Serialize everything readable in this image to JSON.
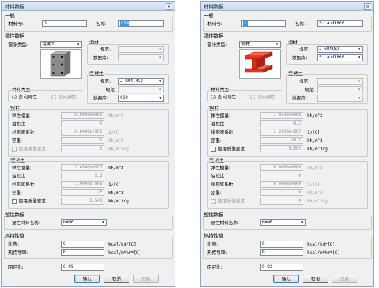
{
  "labels": {
    "dialog_title": "材料数据",
    "close_glyph": "x",
    "general": "一般",
    "mat_no": "材料号:",
    "name": "名称:",
    "elastic": "弹性数据",
    "design_type": "设计类型:",
    "steel_group": "钢材",
    "code": "规范:",
    "database": "数据库:",
    "concrete_group": "混凝土",
    "code_cn": "规范",
    "mat_type": "材料类型",
    "iso": "各向同性",
    "aniso": "各向异性",
    "steel_sec": "钢材",
    "concrete_sec": "混凝土",
    "modulus": "弹性模量:",
    "poisson": "泊松比:",
    "thermal": "线膨胀系数:",
    "weight": "容重:",
    "use_mass": "使用质量密度",
    "u_modulus": "kN/m^2",
    "u_thermal": "1/[C]",
    "u_weight": "kN/m^3",
    "u_mass": "kN/m^3/g",
    "plastic": "塑性数据",
    "plastic_name": "塑性材料名称:",
    "heat": "热特性值",
    "specific_heat": "比热:",
    "conductivity": "热传导率:",
    "u_specific_heat": "kcal/kN*[C]",
    "u_conductivity": "kcal/m*hr*[C]",
    "damping": "阻尼比:",
    "ok": "确认",
    "cancel": "取消",
    "apply": "适用"
  },
  "left": {
    "mat_no": "1",
    "name": "C50",
    "design_type": "混凝土",
    "steel_code": "",
    "steel_db": "",
    "conc_code": "JTG04(RC)",
    "conc_code2": "",
    "conc_db": "C50",
    "steel_modulus": "0.0000e+000",
    "steel_poisson": "0",
    "steel_thermal": "0.0000e+000",
    "steel_weight": "0",
    "steel_mass": "0",
    "conc_modulus": "3.4500e+007",
    "conc_poisson": "0.2",
    "conc_thermal": "1.0000e-005",
    "conc_weight": "25",
    "conc_mass": "2.549",
    "plastic_name": "NONE",
    "specific_heat": "0",
    "conductivity": "0",
    "damping": "0.05"
  },
  "right": {
    "mat_no": "1",
    "name": "Strand1860",
    "design_type": "钢材",
    "steel_code": "JTG04(S)",
    "steel_db": "Strand1860",
    "conc_code": "",
    "conc_code2": "",
    "conc_db": "",
    "steel_modulus": "1.9500e+008",
    "steel_poisson": "0.3",
    "steel_thermal": "1.2000e-005",
    "steel_weight": "78.5",
    "steel_mass": "8.005",
    "conc_modulus": "0.0000e+000",
    "conc_poisson": "0",
    "conc_thermal": "0.0000e+000",
    "conc_weight": "0",
    "conc_mass": "0",
    "plastic_name": "NONE",
    "specific_heat": "0",
    "conductivity": "0",
    "damping": "0.02"
  },
  "icons": {
    "concrete_preview": "concrete-column-icon",
    "steel_preview": "steel-i-beam-icon"
  },
  "colors": {
    "steel_beam": "#e8361c",
    "concrete": "#8c8c8c",
    "selection": "#3399ff"
  }
}
